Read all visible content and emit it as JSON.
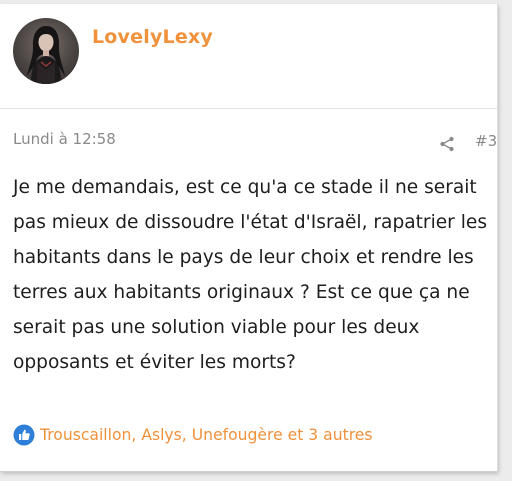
{
  "author": {
    "username": "LovelyLexy",
    "avatar_icon": "user-avatar"
  },
  "post": {
    "date": "Lundi à 12:58",
    "number": "#3",
    "share_icon": "share-icon",
    "body": "Je me demandais, est ce qu'a ce stade il ne serait pas mieux de dissoudre l'état d'Israël, rapatrier les habitants dans le pays de leur choix et rendre les terres aux habitants originaux ? Est ce que ça ne serait pas une solution viable pour les deux opposants et éviter les morts?"
  },
  "reactions": {
    "icon": "like-icon",
    "text": "Trouscaillon, Aslys, Unefougère et 3 autres"
  },
  "colors": {
    "accent": "#f0913b",
    "like_blue": "#2f7ed8",
    "meta_gray": "#8a8a8a",
    "text": "#1e1e1e"
  }
}
